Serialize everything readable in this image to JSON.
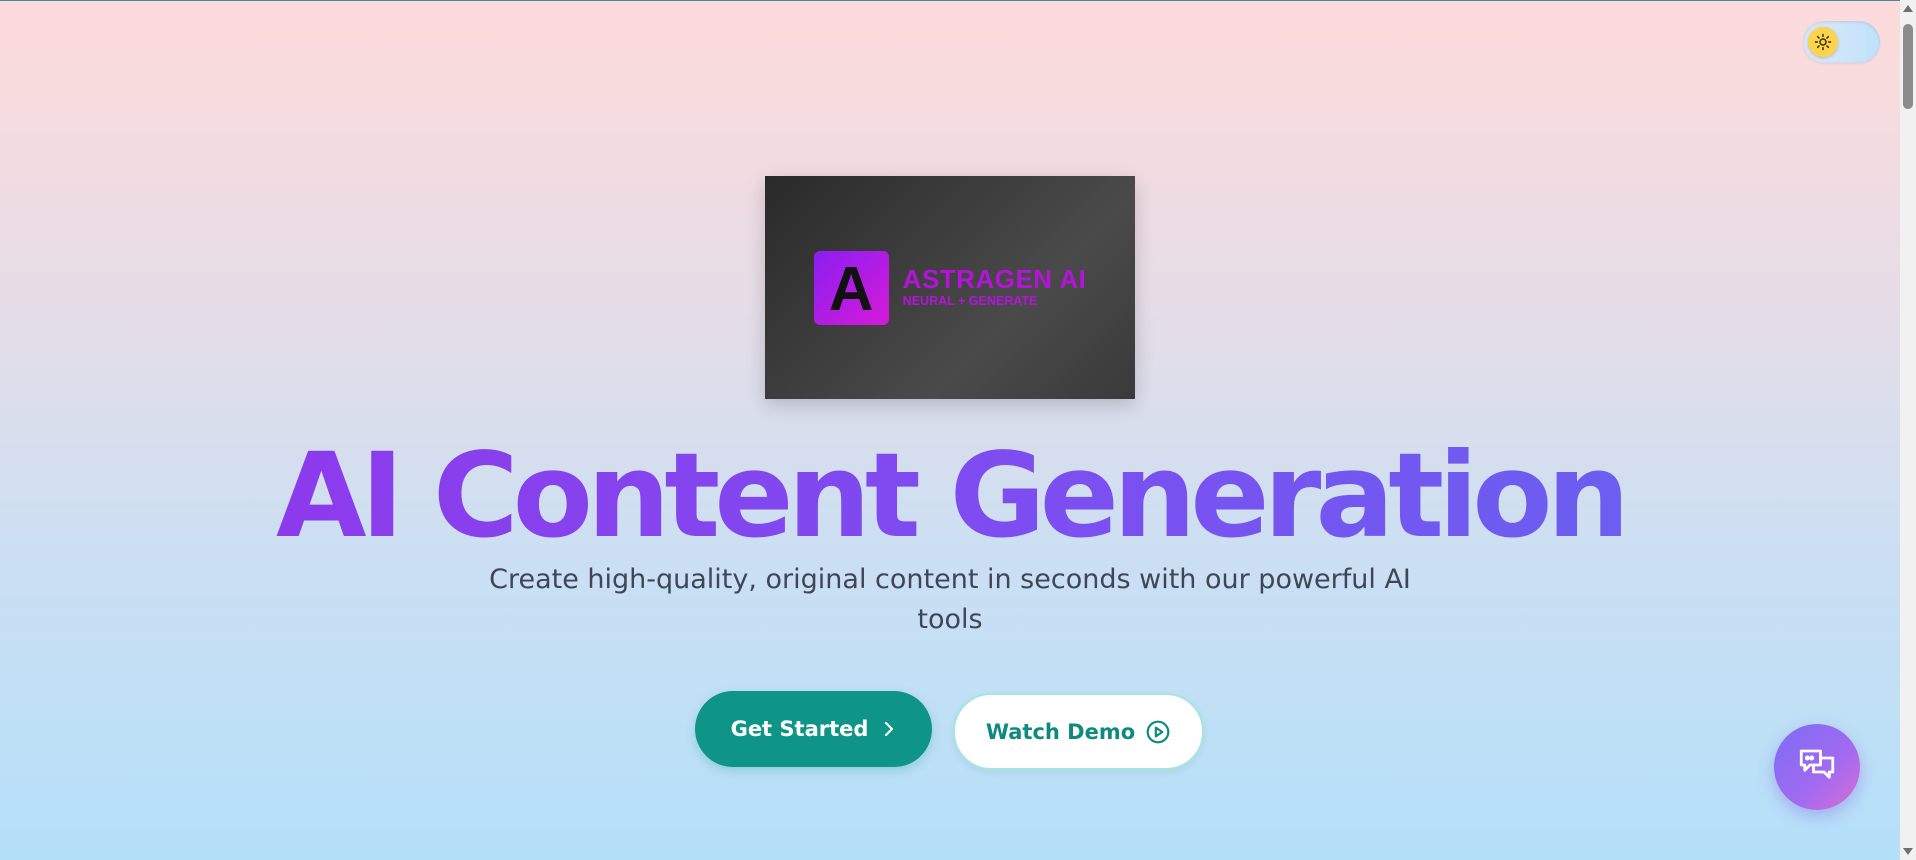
{
  "theme_toggle": {
    "icon": "sun-icon",
    "state": "light"
  },
  "logo": {
    "letter": "A",
    "name": "ASTRAGEN AI",
    "tagline": "NEURAL + GENERATE"
  },
  "hero": {
    "title": "AI Content Generation",
    "subtitle": "Create high-quality, original content in seconds with our powerful AI tools"
  },
  "buttons": {
    "primary_label": "Get Started",
    "secondary_label": "Watch Demo"
  },
  "chat": {
    "icon": "chat-bubbles-icon"
  },
  "colors": {
    "accent": "#0f9488",
    "title_gradient_start": "#9333ea",
    "title_gradient_end": "#6366f1",
    "brand_magenta": "#b413d8"
  }
}
